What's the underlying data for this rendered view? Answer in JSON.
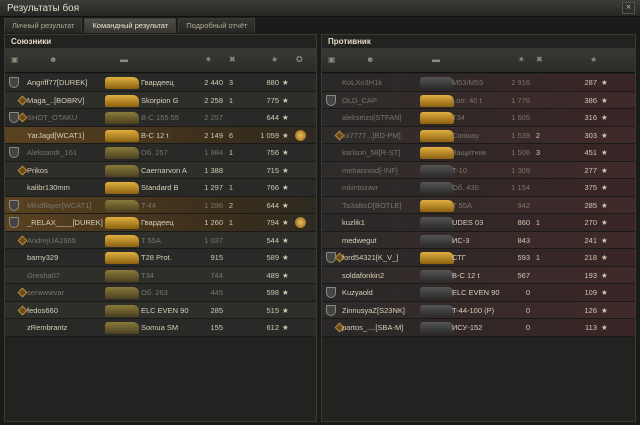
{
  "window": {
    "title": "Результаты боя",
    "close": "×"
  },
  "tabs": [
    {
      "label": "Личный результат"
    },
    {
      "label": "Командный результат"
    },
    {
      "label": "Подробный отчёт"
    }
  ],
  "allies": {
    "title": "Союзники",
    "rows": [
      {
        "name": "Angriff77[DUREK]",
        "tank": "Гвардеец",
        "dmg": "2 440",
        "kills": "3",
        "xp": "880"
      },
      {
        "name": "Maga_..[BOBRV]",
        "tank": "Skorpion G",
        "dmg": "2 258",
        "kills": "1",
        "xp": "775"
      },
      {
        "name": "SHOT_OTAKU",
        "tank": "B-C 155 55",
        "dmg": "2 257",
        "kills": "",
        "xp": "644"
      },
      {
        "name": "YarJagd[WCAT1]",
        "tank": "B-C 12 t",
        "dmg": "2 149",
        "kills": "6",
        "xp": "1 059"
      },
      {
        "name": "Aleksandr_161",
        "tank": "Об. 257",
        "dmg": "1 984",
        "kills": "1",
        "xp": "756"
      },
      {
        "name": "Prikos",
        "tank": "Caernarvon A",
        "dmg": "1 388",
        "kills": "",
        "xp": "715"
      },
      {
        "name": "kalibr130mm",
        "tank": "Standard B",
        "dmg": "1 297",
        "kills": "1",
        "xp": "766"
      },
      {
        "name": "Mindflayer[WCAT1]",
        "tank": "T-44",
        "dmg": "1 286",
        "kills": "2",
        "xp": "644"
      },
      {
        "name": "_RELAX____[DUREK]",
        "tank": "Гвардеец",
        "dmg": "1 260",
        "kills": "1",
        "xp": "794"
      },
      {
        "name": "AndrejUA1965",
        "tank": "T 55A",
        "dmg": "1 037",
        "kills": "",
        "xp": "544"
      },
      {
        "name": "barny329",
        "tank": "T28 Prot.",
        "dmg": "915",
        "kills": "",
        "xp": "589"
      },
      {
        "name": "Gresha07",
        "tank": "T34",
        "dmg": "744",
        "kills": "",
        "xp": "489"
      },
      {
        "name": "serwwwvar",
        "tank": "Об. 263",
        "dmg": "445",
        "kills": "",
        "xp": "598"
      },
      {
        "name": "fedos660",
        "tank": "ELC EVEN 90",
        "dmg": "285",
        "kills": "",
        "xp": "515"
      },
      {
        "name": "zRembrantz",
        "tank": "Somua SM",
        "dmg": "155",
        "kills": "",
        "xp": "612"
      }
    ]
  },
  "enemies": {
    "title": "Противник",
    "rows": [
      {
        "name": "KoLXo3H1k",
        "tank": "M53/M55",
        "dmg": "2 916",
        "kills": "",
        "xp": "287"
      },
      {
        "name": "OLD_CAP",
        "tank": "Lorr. 40 t",
        "dmg": "1 776",
        "kills": "",
        "xp": "386"
      },
      {
        "name": "alekseizo[STFAN]",
        "tank": "T34",
        "dmg": "1 605",
        "kills": "",
        "xp": "316"
      },
      {
        "name": "xx7777...[BD-PM]",
        "tank": "Conway",
        "dmg": "1 539",
        "kills": "2",
        "xp": "303"
      },
      {
        "name": "karlson_58[R-ST]",
        "tank": "Защитник",
        "dmg": "1 506",
        "kills": "3",
        "xp": "451"
      },
      {
        "name": "mehannoid[-INF]",
        "tank": "T-10",
        "dmg": "1 309",
        "kills": "",
        "xp": "277"
      },
      {
        "name": "mkintozavr",
        "tank": "Об. 430",
        "dmg": "1 154",
        "kills": "",
        "xp": "375"
      },
      {
        "name": "Ta3aBoD[BOTLE]",
        "tank": "T 55A",
        "dmg": "942",
        "kills": "",
        "xp": "285"
      },
      {
        "name": "kuzlik1",
        "tank": "UDES 03",
        "dmg": "860",
        "kills": "1",
        "xp": "270"
      },
      {
        "name": "medwegut",
        "tank": "ИС-3",
        "dmg": "843",
        "kills": "",
        "xp": "241"
      },
      {
        "name": "ford54321[K_V_]",
        "tank": "СТГ",
        "dmg": "593",
        "kills": "1",
        "xp": "218"
      },
      {
        "name": "soldafonkin2",
        "tank": "B-C 12 t",
        "dmg": "567",
        "kills": "",
        "xp": "193"
      },
      {
        "name": "Kuzyaold",
        "tank": "ELC EVEN 90",
        "dmg": "0",
        "kills": "",
        "xp": "109"
      },
      {
        "name": "ZinnusyaZ[S23NK]",
        "tank": "T-44-100 (P)",
        "dmg": "0",
        "kills": "",
        "xp": "126"
      },
      {
        "name": "partos_....[SBA-M]",
        "tank": "ИСУ-152",
        "dmg": "0",
        "kills": "",
        "xp": "113"
      }
    ]
  },
  "star": "★"
}
